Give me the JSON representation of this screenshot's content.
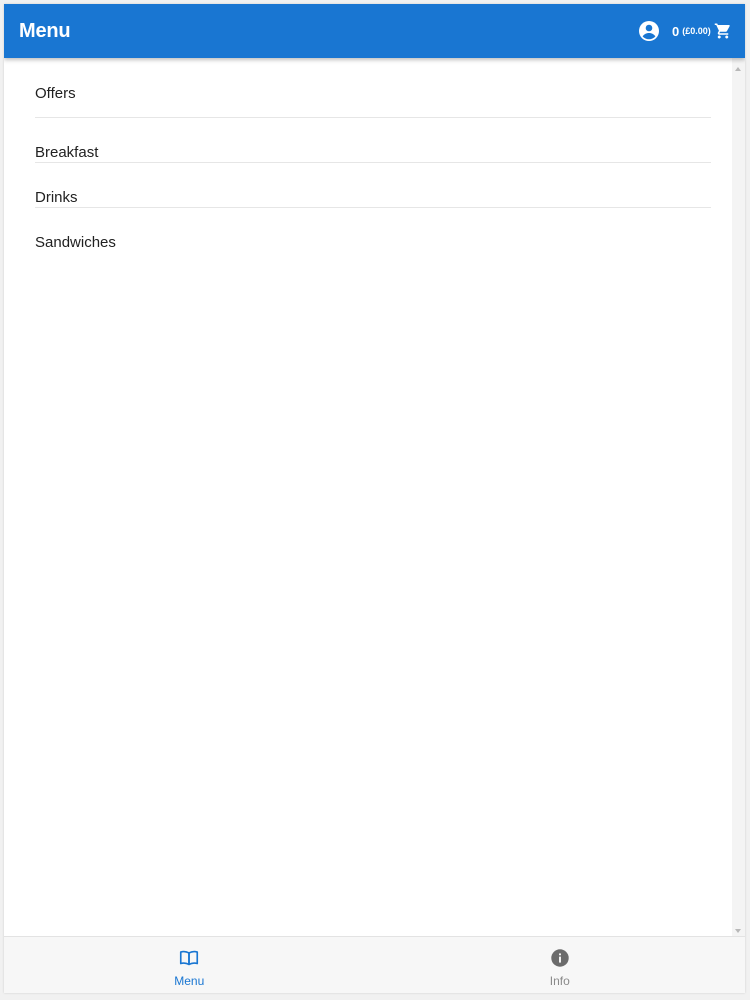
{
  "header": {
    "title": "Menu",
    "account_icon": "account-circle-icon",
    "cart": {
      "count": "0",
      "total": "(£0.00)",
      "icon": "shopping-cart-icon"
    }
  },
  "categories": [
    {
      "label": "Offers"
    },
    {
      "label": "Breakfast"
    },
    {
      "label": "Drinks"
    },
    {
      "label": "Sandwiches"
    }
  ],
  "bottom_nav": {
    "items": [
      {
        "label": "Menu",
        "icon": "book-open-icon",
        "active": true
      },
      {
        "label": "Info",
        "icon": "info-icon",
        "active": false
      }
    ]
  },
  "colors": {
    "primary": "#1976d2",
    "inactive_nav": "#8a8a8a",
    "text": "#212121"
  }
}
